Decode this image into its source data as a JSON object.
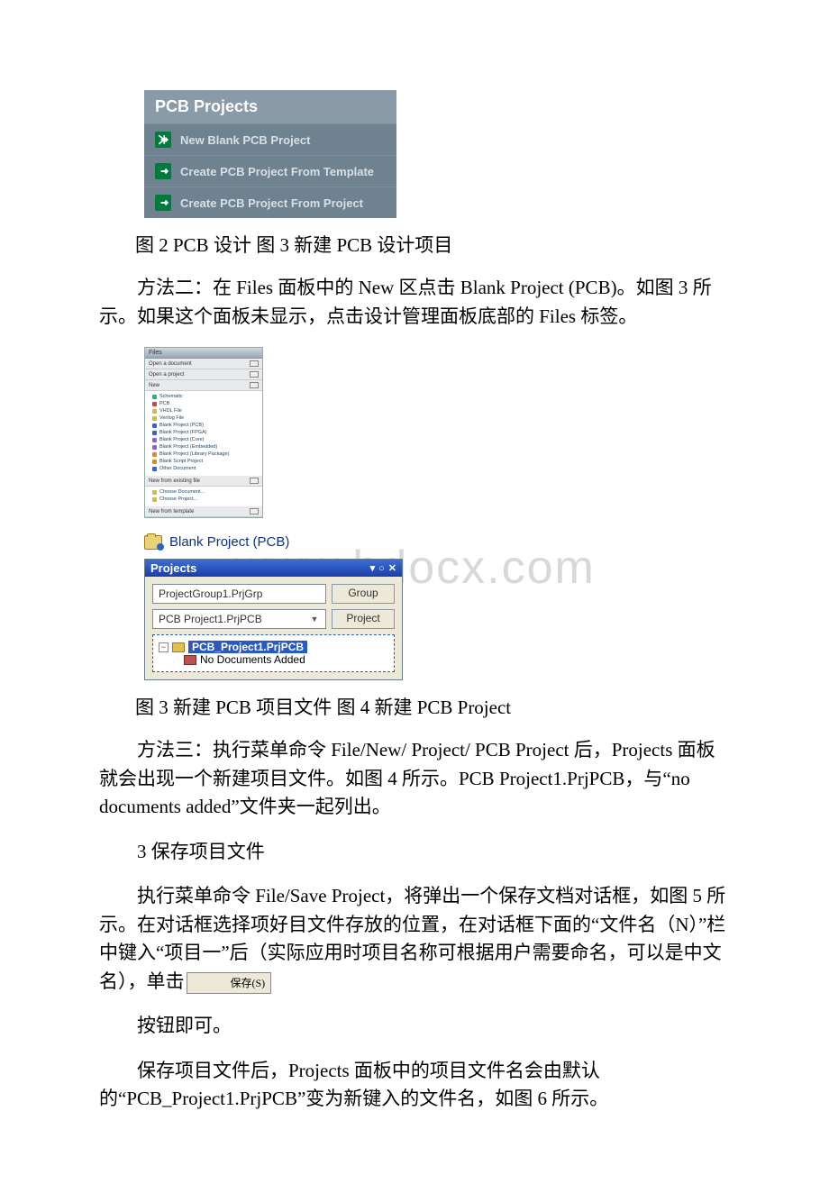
{
  "watermark": "www.bdocx.com",
  "fig2": {
    "header": "PCB Projects",
    "items": [
      "New Blank PCB Project",
      "Create PCB Project From Template",
      "Create PCB Project From Project"
    ]
  },
  "caption_fig2_3": "图 2 PCB 设计 图 3 新建 PCB 设计项目",
  "para_method2": "方法二：在 Files 面板中的 New 区点击 Blank Project (PCB)。如图 3 所示。如果这个面板未显示，点击设计管理面板底部的 Files 标签。",
  "files_panel": {
    "sections": {
      "open_doc": "Open a document",
      "open_proj": "Open a project",
      "new_header": "New",
      "new_from_existing": "New from existing file",
      "new_from_template": "New from template"
    },
    "new_items": [
      "Schematic",
      "PCB",
      "VHDL File",
      "Verilog File",
      "Blank Project (PCB)",
      "Blank Project (FPGA)",
      "Blank Project (Core)",
      "Blank Project (Embedded)",
      "Blank Project (Library Package)",
      "Blank Script Project",
      "Other Document"
    ],
    "existing_items": [
      "Choose Document...",
      "Choose Project..."
    ]
  },
  "blank_proj_link": "Blank Project (PCB)",
  "projects_panel": {
    "title": "Projects",
    "group_field": "ProjectGroup1.PrjGrp",
    "group_btn": "Group",
    "proj_field": "PCB Project1.PrjPCB",
    "proj_btn": "Project",
    "tree_selected": "PCB_Project1.PrjPCB",
    "tree_child": "No Documents Added"
  },
  "caption_fig3_4": "图 3 新建 PCB 项目文件 图 4 新建 PCB Project",
  "para_method3": "方法三：执行菜单命令 File/New/ Project/ PCB Project 后，Projects 面板就会出现一个新建项目文件。如图 4 所示。PCB Project1.PrjPCB，与“no documents added”文件夹一起列出。",
  "heading_save": "3 保存项目文件",
  "para_save_1_a": "执行菜单命令 File/Save Project，将弹出一个保存文档对话框，如图 5 所示。在对话框选择项好目文件存放的位置，在对话框下面的“文件名（N）”栏中键入“项目一”后（实际应用时项目名称可根据用户需要命名，可以是中文名），单击",
  "save_btn_label": "保存(S)",
  "para_save_2": "按钮即可。",
  "para_save_3": "保存项目文件后，Projects 面板中的项目文件名会由默认的“PCB_Project1.PrjPCB”变为新键入的文件名，如图 6 所示。"
}
